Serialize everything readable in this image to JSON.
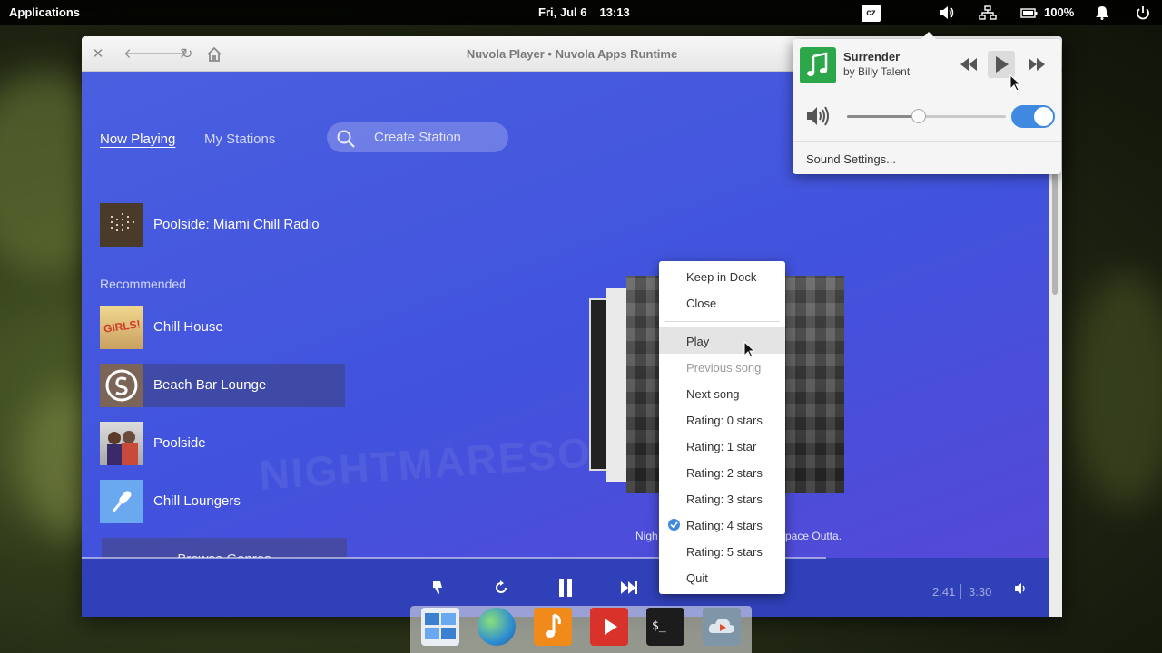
{
  "panel": {
    "applications": "Applications",
    "date": "Fri, Jul  6",
    "time": "13:13",
    "keyboard_layout": "cz",
    "battery": "100%"
  },
  "window": {
    "title": "Nuvola Player • Nuvola Apps Runtime"
  },
  "nav": {
    "now_playing": "Now Playing",
    "my_stations": "My Stations",
    "create_station": "Create Station"
  },
  "current_station": "Poolside: Miami Chill Radio",
  "recommended_label": "Recommended",
  "stations": [
    {
      "name": "Chill House",
      "thumb_text": "GIRLS!"
    },
    {
      "name": "Beach Bar Lounge"
    },
    {
      "name": "Poolside"
    },
    {
      "name": "Chill Loungers"
    }
  ],
  "browse_genres": "Browse Genres",
  "watermark": "NIGHTMARESONWAX",
  "caption": {
    "left": "Nigh",
    "right": "pace Outta."
  },
  "times": {
    "elapsed": "2:41",
    "total": "3:30"
  },
  "playback_progress": 0.77,
  "sound_popover": {
    "song": "Surrender",
    "artist": "by Billy Talent",
    "volume": 0.45,
    "settings": "Sound Settings..."
  },
  "context_menu": {
    "items": [
      "Keep in Dock",
      "Close",
      "Play",
      "Previous song",
      "Next song",
      "Rating: 0 stars",
      "Rating: 1 star",
      "Rating: 2 stars",
      "Rating: 3 stars",
      "Rating: 4 stars",
      "Rating: 5 stars",
      "Quit"
    ]
  },
  "colors": {
    "app_bg": "#4153dd",
    "bottom_bar": "#3040b8",
    "accent": "#3f8ae0",
    "music_icon": "#2ca84a"
  }
}
